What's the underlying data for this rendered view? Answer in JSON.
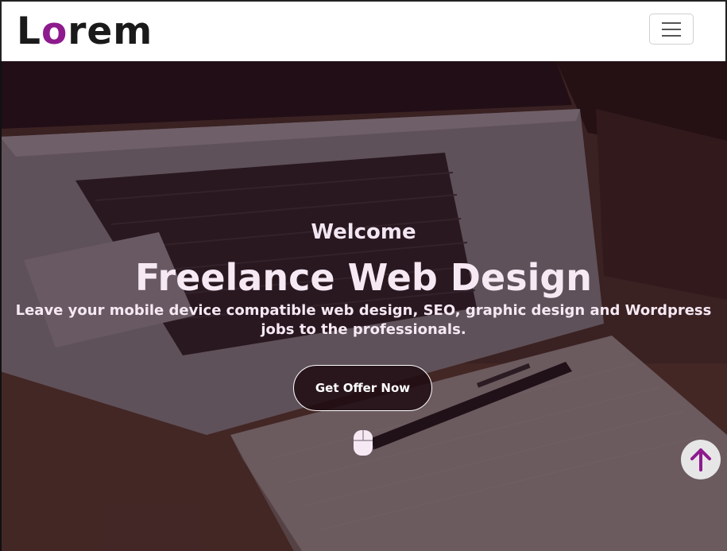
{
  "navbar": {
    "logo_first": "L",
    "logo_o": "o",
    "logo_rest": "rem",
    "brand_color": "#8e1a8e",
    "toggler_icon": "hamburger-menu-icon"
  },
  "hero": {
    "welcome": "Welcome",
    "headline": "Freelance Web Design",
    "subtext": "Leave your mobile device compatible web design, SEO, graphic design and Wordpress jobs to the professionals.",
    "cta_label": "Get Offer Now",
    "scroll_indicator_icon": "mouse-icon",
    "background_image": "laptop-notebook-pen-desk"
  },
  "scroll_top": {
    "icon": "arrow-up-icon",
    "icon_color": "#8e1a8e"
  }
}
